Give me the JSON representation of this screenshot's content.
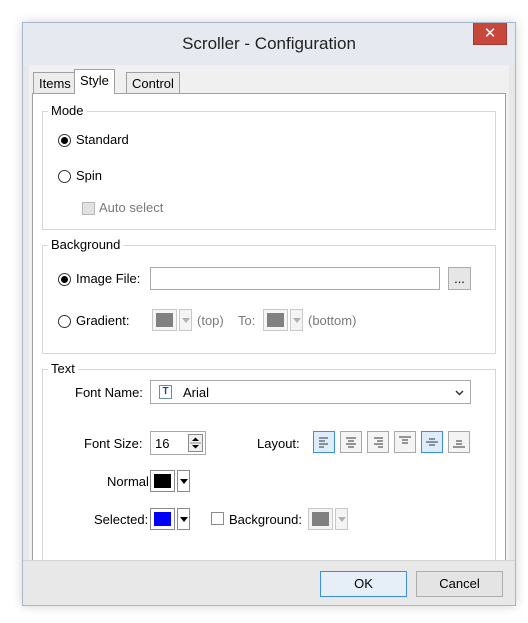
{
  "window": {
    "title": "Scroller - Configuration",
    "close_glyph": "✕"
  },
  "tabs": [
    {
      "label": "Items"
    },
    {
      "label": "Style"
    },
    {
      "label": "Control"
    }
  ],
  "mode": {
    "legend": "Mode",
    "standard_label": "Standard",
    "spin_label": "Spin",
    "auto_select_label": "Auto select",
    "selected": "standard"
  },
  "background": {
    "legend": "Background",
    "image_file_label": "Image File:",
    "image_file_value": "",
    "browse_label": "...",
    "gradient_label": "Gradient:",
    "top_hint": "(top)",
    "to_label": "To:",
    "bottom_hint": "(bottom)",
    "selected": "image_file",
    "gradient_top_color": "#808080",
    "gradient_bottom_color": "#808080"
  },
  "text": {
    "legend": "Text",
    "font_name_label": "Font Name:",
    "font_name_value": "Arial",
    "font_size_label": "Font Size:",
    "font_size_value": "16",
    "layout_label": "Layout:",
    "normal_label": "Normal:",
    "normal_color": "#000000",
    "selected_label": "Selected:",
    "selected_color": "#0000ff",
    "background_label": "Background:",
    "background_color": "#808080",
    "layout_options": [
      "align-left-icon",
      "align-center-icon",
      "align-right-icon",
      "align-top-icon",
      "align-middle-icon",
      "align-bottom-icon"
    ],
    "layout_selected": [
      "align-left-icon",
      "align-middle-icon"
    ]
  },
  "buttons": {
    "ok_label": "OK",
    "cancel_label": "Cancel"
  }
}
